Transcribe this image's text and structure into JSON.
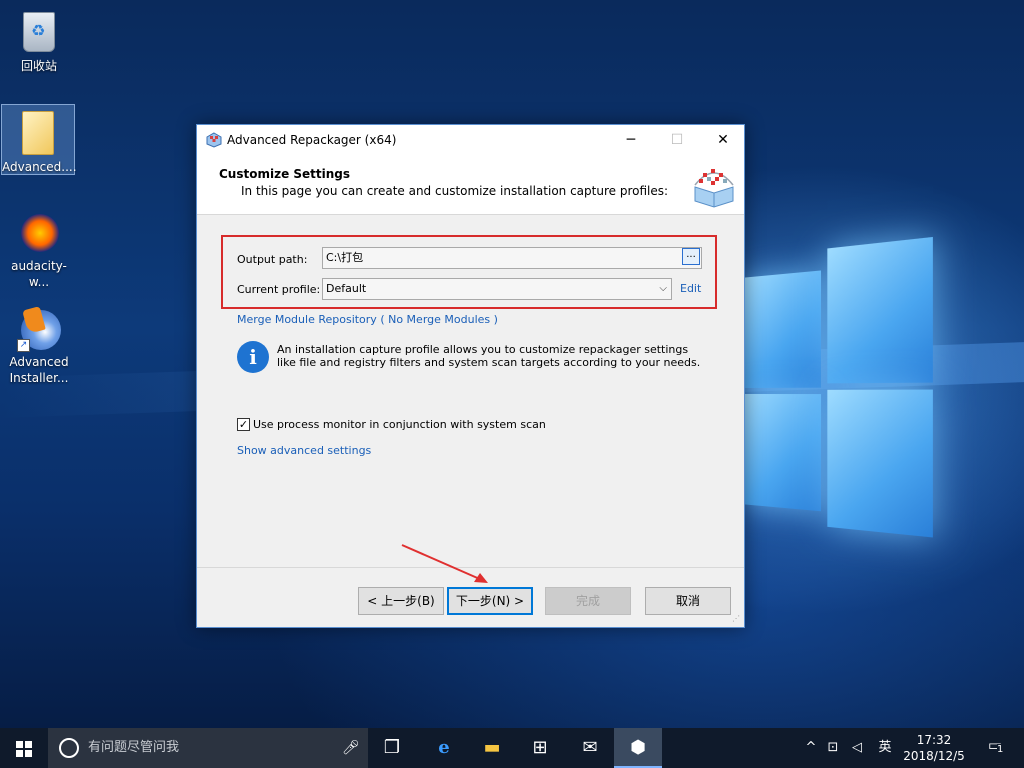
{
  "desktop": {
    "icons": [
      {
        "label": "回收站",
        "icon": "recycle-bin-icon"
      },
      {
        "label": "Advanced....",
        "icon": "folder-icon"
      },
      {
        "label": "audacity-w...",
        "icon": "audacity-icon"
      },
      {
        "label": "Advanced\nInstaller...",
        "icon": "advanced-installer-icon"
      }
    ],
    "icon_labels": {
      "recycle_bin": "回收站",
      "advanced_folder": "Advanced....",
      "audacity": "audacity-w...",
      "adv_installer_line1": "Advanced",
      "adv_installer_line2": "Installer..."
    }
  },
  "dialog": {
    "title": "Advanced Repackager (x64)",
    "titlebar_buttons": {
      "minimize": "─",
      "maximize": "☐",
      "close": "✕"
    },
    "header": {
      "title": "Customize Settings",
      "subtitle": "In this page you can create and customize installation capture profiles:"
    },
    "output_path": {
      "label": "Output path:",
      "value": "C:\\打包",
      "browse": "..."
    },
    "current_profile": {
      "label": "Current profile:",
      "value": "Default",
      "edit_link": "Edit"
    },
    "merge_module_link": "Merge Module Repository ( No Merge Modules )",
    "info_text": "An installation capture profile allows you to customize repackager settings like file and registry filters and system scan targets according to your needs.",
    "process_monitor": {
      "checked": true,
      "label": "Use process monitor in conjunction with system scan"
    },
    "show_advanced_link": "Show advanced settings",
    "buttons": {
      "back": "< 上一步(B)",
      "next": "下一步(N) >",
      "finish": "完成",
      "cancel": "取消"
    }
  },
  "taskbar": {
    "search_placeholder": "有问题尽管问我",
    "ime": "英",
    "time": "17:32",
    "date": "2018/12/5",
    "notification_count": "1"
  },
  "colors": {
    "highlight_red": "#d72b2b",
    "link_blue": "#1a5fb8",
    "accent": "#0078d7"
  }
}
